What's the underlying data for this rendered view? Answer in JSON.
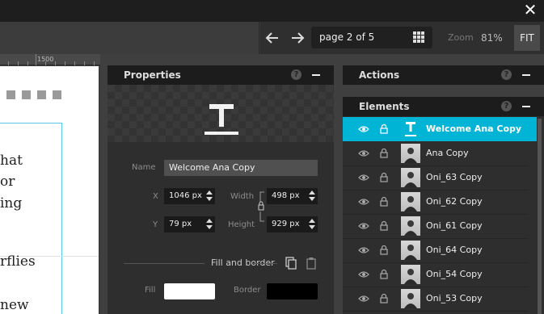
{
  "toolbar": {
    "page_indicator": "page 2 of 5",
    "zoom_label": "Zoom",
    "zoom_value": "81%",
    "fit_label": "FIT"
  },
  "canvas": {
    "ruler_label": "1500",
    "text_fragments": [
      "hat",
      "or",
      "ing",
      "rflies",
      "new"
    ]
  },
  "properties": {
    "title": "Properties",
    "name_label": "Name",
    "name_value": "Welcome Ana Copy",
    "x_label": "X",
    "x_value": "1046 px",
    "y_label": "Y",
    "y_value": "79 px",
    "width_label": "Width",
    "width_value": "498 px",
    "height_label": "Height",
    "height_value": "929 px",
    "fill_border_title": "Fill and border",
    "fill_label": "Fill",
    "border_label": "Border",
    "fill_color": "#ffffff",
    "border_color": "#000000"
  },
  "actions": {
    "title": "Actions"
  },
  "elements": {
    "title": "Elements",
    "selected_color": "#00b4d6",
    "items": [
      {
        "label": "Welcome Ana Copy",
        "type": "text"
      },
      {
        "label": "Ana Copy",
        "type": "image"
      },
      {
        "label": "Oni_63 Copy",
        "type": "image"
      },
      {
        "label": "Oni_62 Copy",
        "type": "image"
      },
      {
        "label": "Oni_61 Copy",
        "type": "image"
      },
      {
        "label": "Oni_64 Copy",
        "type": "image"
      },
      {
        "label": "Oni_54 Copy",
        "type": "image"
      },
      {
        "label": "Oni_53 Copy",
        "type": "image"
      }
    ]
  }
}
